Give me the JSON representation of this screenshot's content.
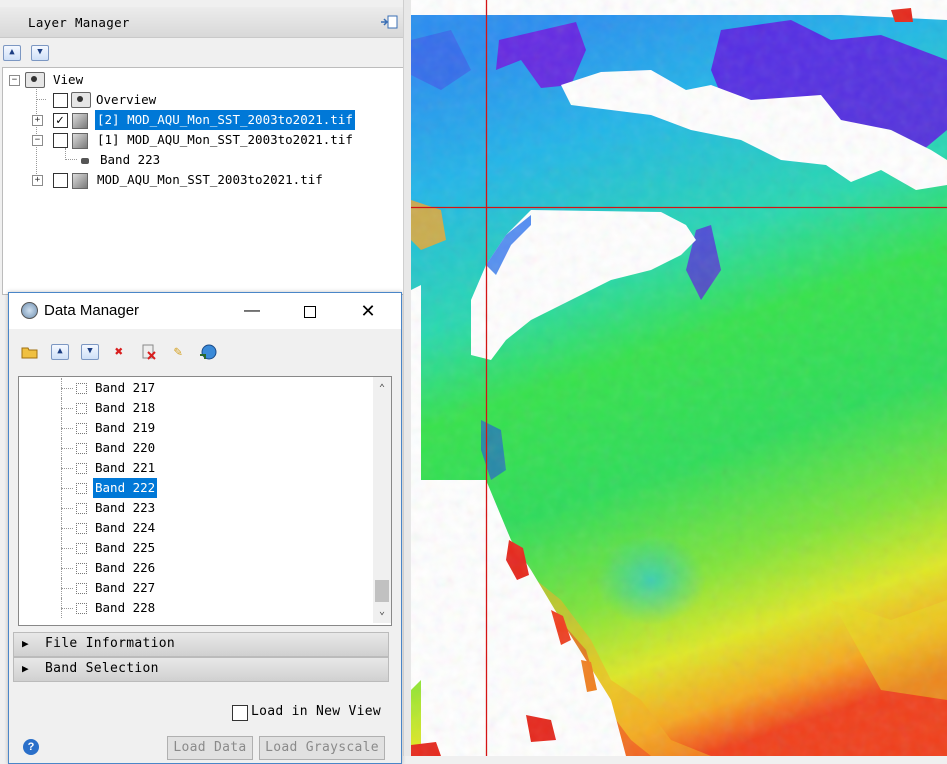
{
  "layer_manager": {
    "title": "Layer Manager",
    "tree": {
      "root_label": "View",
      "overview_label": "Overview",
      "layers": [
        {
          "label": "[2] MOD_AQU_Mon_SST_2003to2021.tif",
          "checked": true,
          "selected": true
        },
        {
          "label": "[1] MOD_AQU_Mon_SST_2003to2021.tif",
          "checked": false,
          "selected": false
        },
        {
          "label": "MOD_AQU_Mon_SST_2003to2021.tif",
          "checked": false,
          "selected": false
        }
      ],
      "sub_band_label": "Band 223"
    }
  },
  "data_manager": {
    "title": "Data Manager",
    "bands": [
      "Band 217",
      "Band 218",
      "Band 219",
      "Band 220",
      "Band 221",
      "Band 222",
      "Band 223",
      "Band 224",
      "Band 225",
      "Band 226",
      "Band 227",
      "Band 228"
    ],
    "selected_band": "Band 222",
    "sections": [
      "File Information",
      "Band Selection"
    ],
    "load_in_new_view_label": "Load in New View",
    "load_data_label": "Load Data",
    "load_grayscale_label": "Load Grayscale",
    "help_label": "?"
  },
  "map": {
    "description_colors": {
      "purple": "#6a1fe0",
      "blue": "#2f7ff0",
      "cyan": "#1fd0d8",
      "green": "#28e04a",
      "yellow": "#e8e81e",
      "orange": "#f49a1c",
      "red": "#e8221c",
      "crosshair": "#d41414"
    }
  }
}
